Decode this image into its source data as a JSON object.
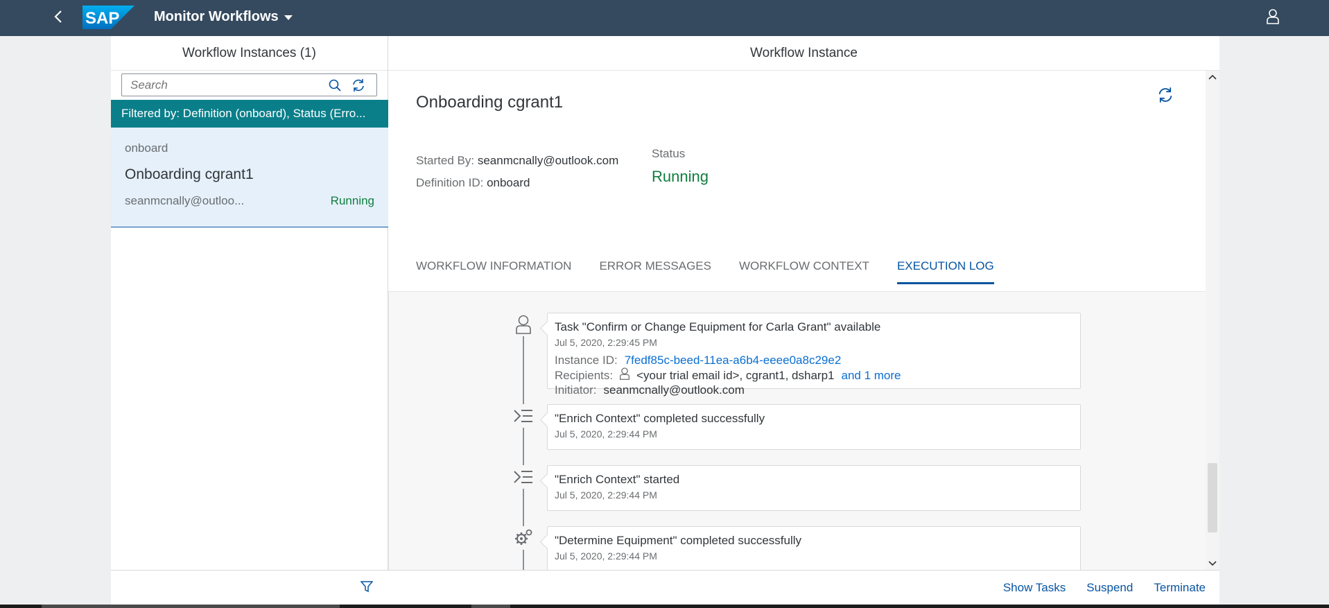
{
  "shell": {
    "app_title": "Monitor Workflows",
    "logo_text": "SAP"
  },
  "master": {
    "header": "Workflow Instances (1)",
    "search_placeholder": "Search",
    "filter_info": "Filtered by: Definition (onboard), Status (Erro...",
    "items": [
      {
        "definition": "onboard",
        "name": "Onboarding cgrant1",
        "owner": "seanmcnally@outloo...",
        "status": "Running"
      }
    ]
  },
  "detail": {
    "header": "Workflow Instance",
    "title": "Onboarding cgrant1",
    "started_by_label": "Started By:",
    "started_by": "seanmcnally@outlook.com",
    "definition_label": "Definition ID:",
    "definition_id": "onboard",
    "status_label": "Status",
    "status": "Running",
    "tabs": [
      {
        "label": "WORKFLOW INFORMATION",
        "active": false
      },
      {
        "label": "ERROR MESSAGES",
        "active": false
      },
      {
        "label": "WORKFLOW CONTEXT",
        "active": false
      },
      {
        "label": "EXECUTION LOG",
        "active": true
      }
    ],
    "log": [
      {
        "icon": "person-icon",
        "title": "Task \"Confirm or Change Equipment for Carla Grant\" available",
        "date": "Jul 5, 2020, 2:29:45 PM",
        "instance_label": "Instance ID:",
        "instance_id": "7fedf85c-beed-11ea-a6b4-eeee0a8c29e2",
        "recipients_label": "Recipients:",
        "recipients": "<your trial email id>, cgrant1, dsharp1",
        "recipients_more": "and 1 more",
        "initiator_label": "Initiator:",
        "initiator": "seanmcnally@outlook.com"
      },
      {
        "icon": "script-task-icon",
        "title": "\"Enrich Context\" completed successfully",
        "date": "Jul 5, 2020, 2:29:44 PM"
      },
      {
        "icon": "script-task-icon",
        "title": "\"Enrich Context\" started",
        "date": "Jul 5, 2020, 2:29:44 PM"
      },
      {
        "icon": "gears-icon",
        "title": "\"Determine Equipment\" completed successfully",
        "date": "Jul 5, 2020, 2:29:44 PM"
      }
    ],
    "footer": {
      "show_tasks": "Show Tasks",
      "suspend": "Suspend",
      "terminate": "Terminate"
    }
  },
  "colors": {
    "shell_bg": "#354a5f",
    "filter_bg": "#0a7f8a",
    "status_positive": "#107e3e",
    "accent": "#0854a0"
  }
}
